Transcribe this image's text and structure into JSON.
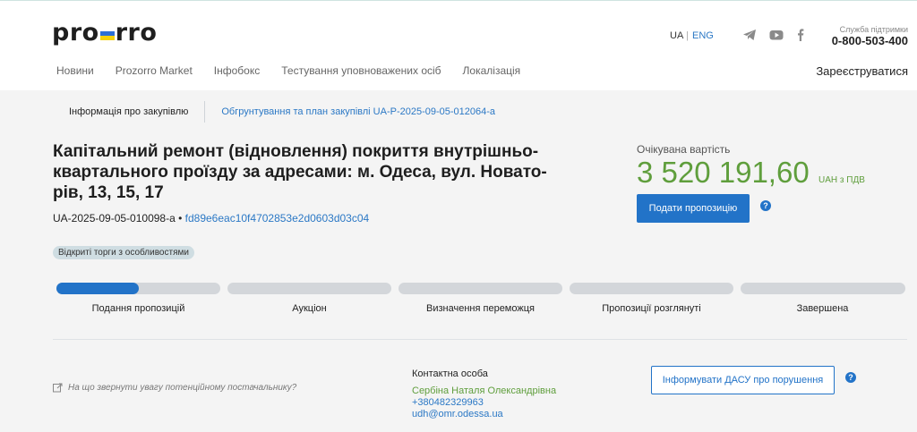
{
  "brand": {
    "logo_left": "pro",
    "logo_mid": "z",
    "logo_right": "rro",
    "flag_blue": "#2b6fd6",
    "flag_yellow": "#f5d20a"
  },
  "header": {
    "lang_ua": "UA",
    "lang_sep": "|",
    "lang_eng": "ENG",
    "social": [
      "telegram-icon",
      "youtube-icon",
      "facebook-icon"
    ],
    "support_label": "Служба підтримки",
    "support_phone": "0-800-503-400",
    "register": "Зареєструватися"
  },
  "nav": [
    "Новини",
    "Prozorro Market",
    "Інфобокс",
    "Тестування уповноважених осіб",
    "Локалізація"
  ],
  "tabs": {
    "info": "Інформація про закупівлю",
    "plan": "Обгрунтування та план закупівлі UA-P-2025-09-05-012064-a"
  },
  "tender": {
    "title": "Капітальний ремонт (відновлення) покриття внутрішньо-квартального проїзду за адресами: м. Одеса, вул. Новато-рів, 13, 15, 17",
    "id": "UA-2025-09-05-010098-a",
    "bullet": "•",
    "hash": "fd89e6eac10f4702853e2d0603d03c04",
    "badge": "Відкриті торги з особливостями"
  },
  "expected": {
    "label": "Очікувана вартість",
    "value": "3 520 191,60",
    "currency": "UAH з ПДВ",
    "submit_label": "Подати пропозицію",
    "help": "?"
  },
  "stages": {
    "active_index": 0,
    "active_fill": 0.5,
    "labels": [
      "Подання пропозицій",
      "Аукціон",
      "Визначення переможця",
      "Пропозиції розглянуті",
      "Завершена"
    ]
  },
  "footer": {
    "attention": "На що звернути увагу потенційному постачальнику?",
    "contact_title": "Контактна особа",
    "contact_name": "Сербіна Наталя Олександрівна",
    "contact_phone": "+380482329963",
    "contact_email": "udh@omr.odessa.ua",
    "dasu_label": "Інформувати ДАСУ про порушення",
    "help": "?"
  }
}
